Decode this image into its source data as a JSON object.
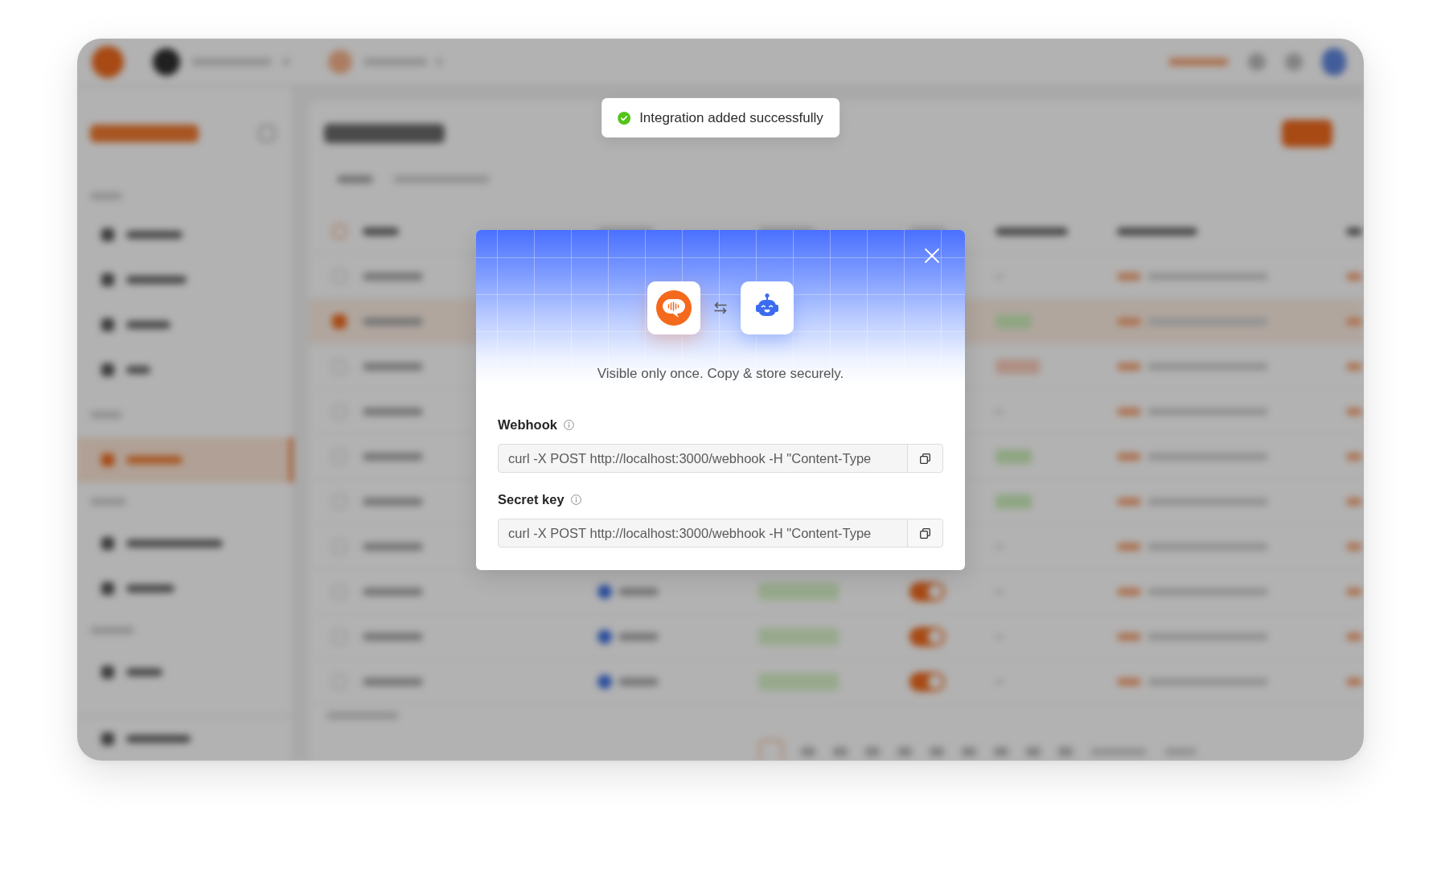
{
  "toast": {
    "kind": "success",
    "message": "Integration added successfully"
  },
  "dialog": {
    "note": "Visible only once. Copy & store securely.",
    "fields": [
      {
        "label": "Webhook",
        "value": "curl -X POST http://localhost:3000/webhook -H \"Content-Type"
      },
      {
        "label": "Secret key",
        "value": "curl -X POST http://localhost:3000/webhook -H \"Content-Type"
      }
    ]
  }
}
